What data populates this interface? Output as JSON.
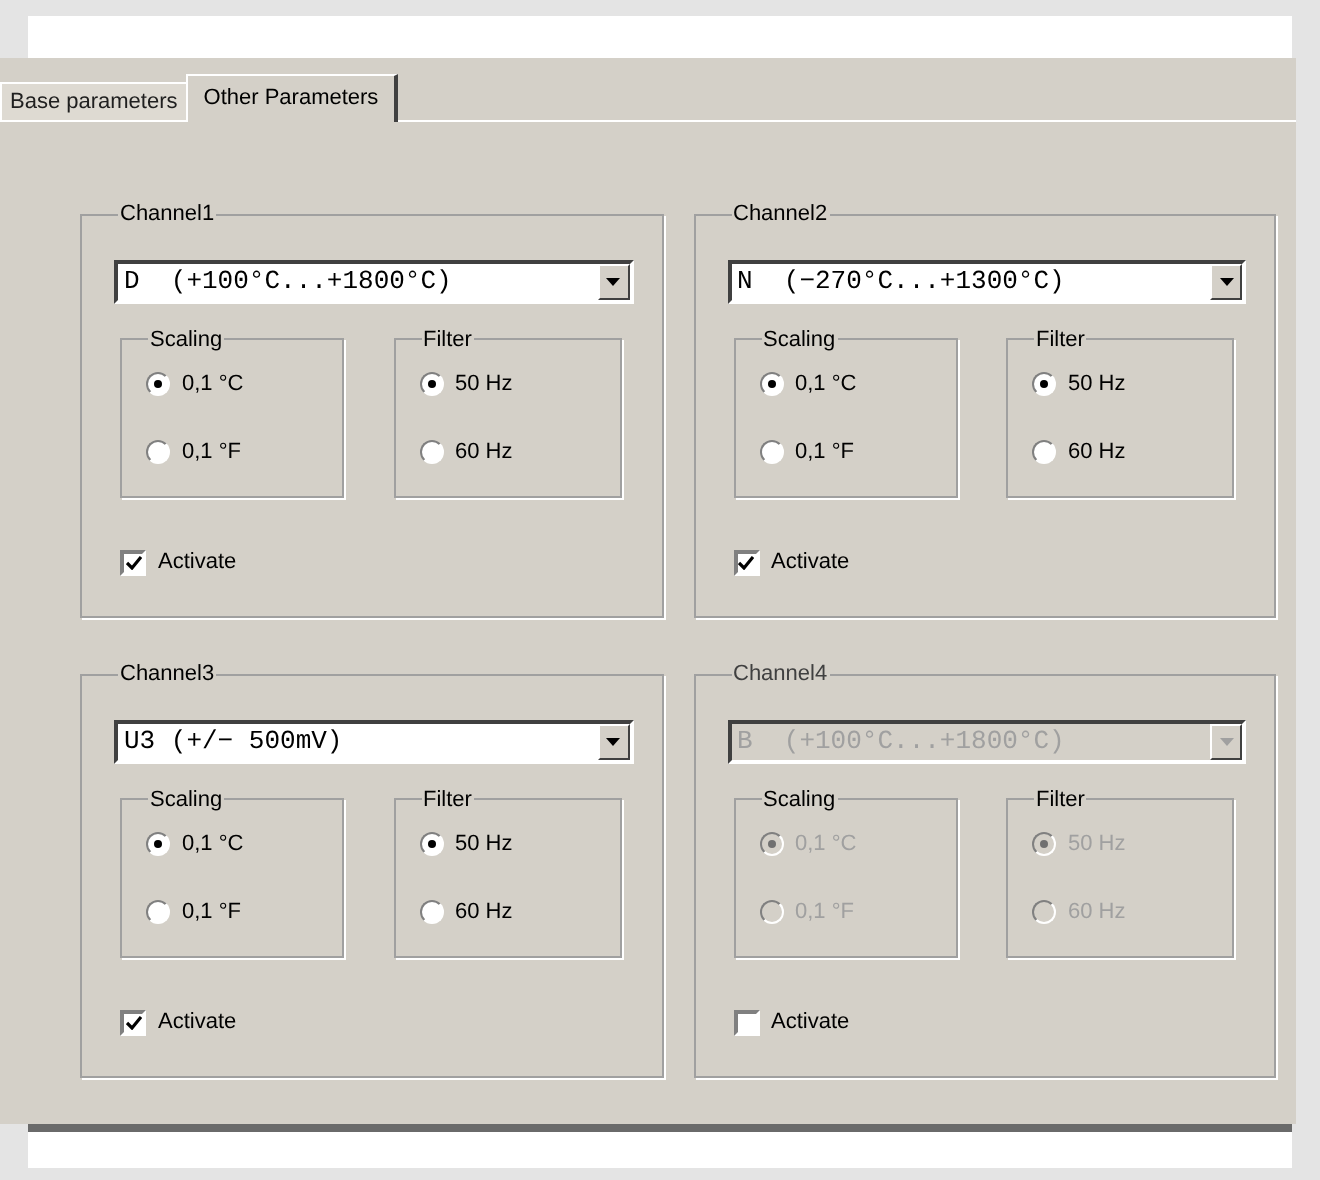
{
  "tabs": [
    {
      "label": "Base parameters",
      "selected": false
    },
    {
      "label": "Other Parameters",
      "selected": true
    }
  ],
  "channels": [
    {
      "title": "Channel1",
      "disabled": false,
      "sensor": "D  (+100°C...+1800°C)",
      "scaling": {
        "title": "Scaling",
        "options": [
          {
            "label": "0,1 °C",
            "selected": true
          },
          {
            "label": "0,1 °F",
            "selected": false
          }
        ]
      },
      "filter": {
        "title": "Filter",
        "options": [
          {
            "label": "50 Hz",
            "selected": true
          },
          {
            "label": "60 Hz",
            "selected": false
          }
        ]
      },
      "activate": {
        "label": "Activate",
        "checked": true
      }
    },
    {
      "title": "Channel2",
      "disabled": false,
      "sensor": "N  (−270°C...+1300°C)",
      "scaling": {
        "title": "Scaling",
        "options": [
          {
            "label": "0,1 °C",
            "selected": true
          },
          {
            "label": "0,1 °F",
            "selected": false
          }
        ]
      },
      "filter": {
        "title": "Filter",
        "options": [
          {
            "label": "50 Hz",
            "selected": true
          },
          {
            "label": "60 Hz",
            "selected": false
          }
        ]
      },
      "activate": {
        "label": "Activate",
        "checked": true
      }
    },
    {
      "title": "Channel3",
      "disabled": false,
      "sensor": "U3 (+/− 500mV)",
      "scaling": {
        "title": "Scaling",
        "options": [
          {
            "label": "0,1 °C",
            "selected": true
          },
          {
            "label": "0,1 °F",
            "selected": false
          }
        ]
      },
      "filter": {
        "title": "Filter",
        "options": [
          {
            "label": "50 Hz",
            "selected": true
          },
          {
            "label": "60 Hz",
            "selected": false
          }
        ]
      },
      "activate": {
        "label": "Activate",
        "checked": true
      }
    },
    {
      "title": "Channel4",
      "disabled": true,
      "sensor": "B  (+100°C...+1800°C)",
      "scaling": {
        "title": "Scaling",
        "options": [
          {
            "label": "0,1 °C",
            "selected": true
          },
          {
            "label": "0,1 °F",
            "selected": false
          }
        ]
      },
      "filter": {
        "title": "Filter",
        "options": [
          {
            "label": "50 Hz",
            "selected": true
          },
          {
            "label": "60 Hz",
            "selected": false
          }
        ]
      },
      "activate": {
        "label": "Activate",
        "checked": false
      }
    }
  ]
}
